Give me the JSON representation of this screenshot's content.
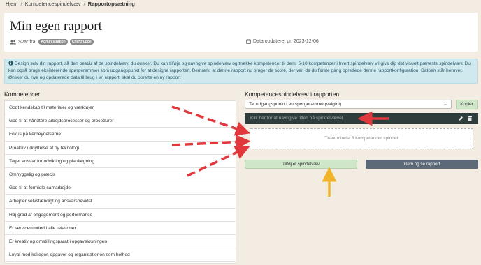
{
  "breadcrumb": {
    "items": [
      "Hjem",
      "Kompetencespindelvæv",
      "Rapportopsætning"
    ],
    "separator": "/"
  },
  "header": {
    "title": "Min egen rapport",
    "svar_label": "Svar fra:",
    "badges": [
      "Administration",
      "Chefgruppe"
    ],
    "updated": "Data opdateret pr. 2023-12-06"
  },
  "info": {
    "text": "Design selv din rapport, så den består af de spindelvæv, du ønsker. Du kan tilføje og navngive spindelvæv og trække kompetencer til dem. 5-10 kompetencer i hvert spindelvæv vil give dig det visuelt pæneste spindelvæv. Du kan også bruge eksisterende spørgerammer som udgangspunkt for at designe rapporten. Bemærk, at denne rapport nu bruger de score, der var, da du første gang oprettede denne rapportkonfiguration. Datoen står herover. Ønsker du nye og opdaterede data til brug i en rapport, skal du oprette en ny rapport"
  },
  "competences": {
    "title": "Kompetencer",
    "items": [
      "Godt kendskab til materialer og værktøjer",
      "God til at håndtere arbejdsprocesser og procedurer",
      "Fokus på kerneydelserne",
      "Proaktiv udnyttelse af ny teknologi",
      "Tager ansvar for udvikling og planlægning",
      "Omhyggelig og præcis",
      "God til at formidle samarbejde",
      "Arbejder selvstændigt og ansvarsbevidst",
      "Høj grad af engagement og performance",
      "Er serviceminded i alle relationer",
      "Er kreativ og omstillingsparat i opgaveløsningen",
      "Loyal mod kolleger, opgaver og organisationen som helhed"
    ]
  },
  "webs": {
    "title": "Kompetencespindelvæv i rapporten",
    "select_value": "Ta' udgangspunkt i en spørgeramme (valgfrit)",
    "copy_button": "Kopiér",
    "web_title_placeholder": "Klik her for at navngive titlen på spindelvævet",
    "dropzone_text": "Træk mindst 3 kompetencer spindet",
    "add_button": "Tilføj et spindelvæv",
    "save_button": "Gem og se rapport"
  },
  "colors": {
    "annotation_red": "#e0383c",
    "annotation_yellow": "#f0b429",
    "web_header_bg": "#2f3d3d",
    "info_bg": "#cfe9ef"
  }
}
